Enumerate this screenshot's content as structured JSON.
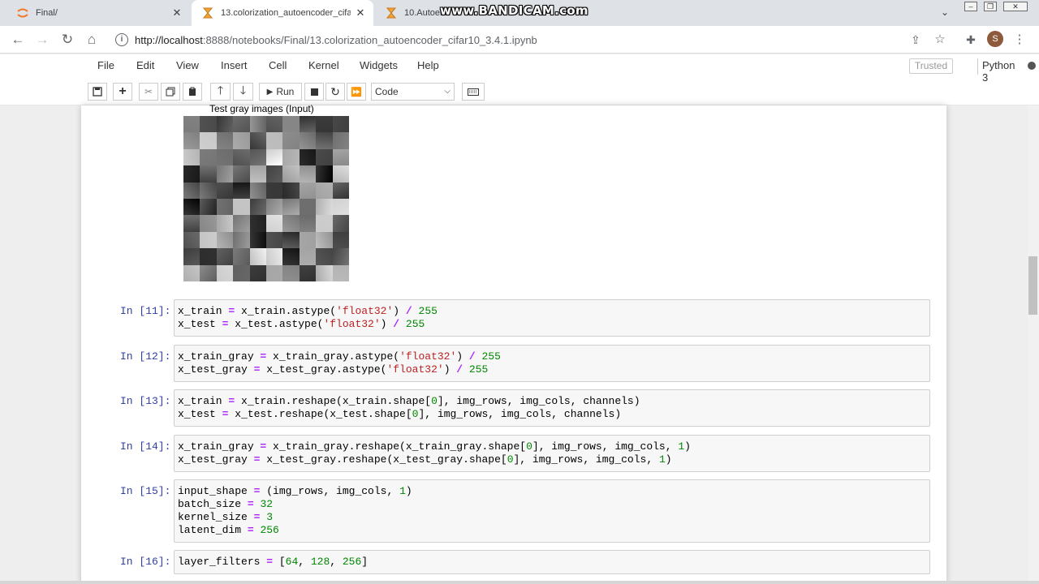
{
  "browser": {
    "tabs": [
      {
        "title": "Final/",
        "icon": "jupyter-logo-icon"
      },
      {
        "title": "13.colorization_autoencoder_cifa",
        "icon": "hourglass-icon"
      },
      {
        "title": "10.Autoen",
        "icon": "hourglass-icon"
      }
    ],
    "watermark": "www.BANDICAM.com",
    "url_host": "http://localhost",
    "url_rest": ":8888/notebooks/Final/13.colorization_autoencoder_cifar10_3.4.1.ipynb",
    "avatar_letter": "S"
  },
  "jupyter": {
    "menu": [
      "File",
      "Edit",
      "View",
      "Insert",
      "Cell",
      "Kernel",
      "Widgets",
      "Help"
    ],
    "trusted": "Trusted",
    "kernel": "Python 3",
    "run_label": "Run",
    "cell_type": "Code"
  },
  "output": {
    "title": "Test gray images (Input)"
  },
  "cells": [
    {
      "prompt": "In [11]:",
      "lines": [
        "x_train = x_train.astype('float32') / 255",
        "x_test = x_test.astype('float32') / 255"
      ]
    },
    {
      "prompt": "In [12]:",
      "lines": [
        "x_train_gray = x_train_gray.astype('float32') / 255",
        "x_test_gray = x_test_gray.astype('float32') / 255"
      ]
    },
    {
      "prompt": "In [13]:",
      "lines": [
        "x_train = x_train.reshape(x_train.shape[0], img_rows, img_cols, channels)",
        "x_test = x_test.reshape(x_test.shape[0], img_rows, img_cols, channels)"
      ]
    },
    {
      "prompt": "In [14]:",
      "lines": [
        "x_train_gray = x_train_gray.reshape(x_train_gray.shape[0], img_rows, img_cols, 1)",
        "x_test_gray = x_test_gray.reshape(x_test_gray.shape[0], img_rows, img_cols, 1)"
      ]
    },
    {
      "prompt": "In [15]:",
      "lines": [
        "input_shape = (img_rows, img_cols, 1)",
        "batch_size = 32",
        "kernel_size = 3",
        "latent_dim = 256"
      ]
    },
    {
      "prompt": "In [16]:",
      "lines": [
        "layer_filters = [64, 128, 256]"
      ]
    }
  ],
  "colors": {
    "prompt": "#303f9f",
    "string": "#ba2121",
    "number": "#008800",
    "operator": "#aa22ff"
  }
}
